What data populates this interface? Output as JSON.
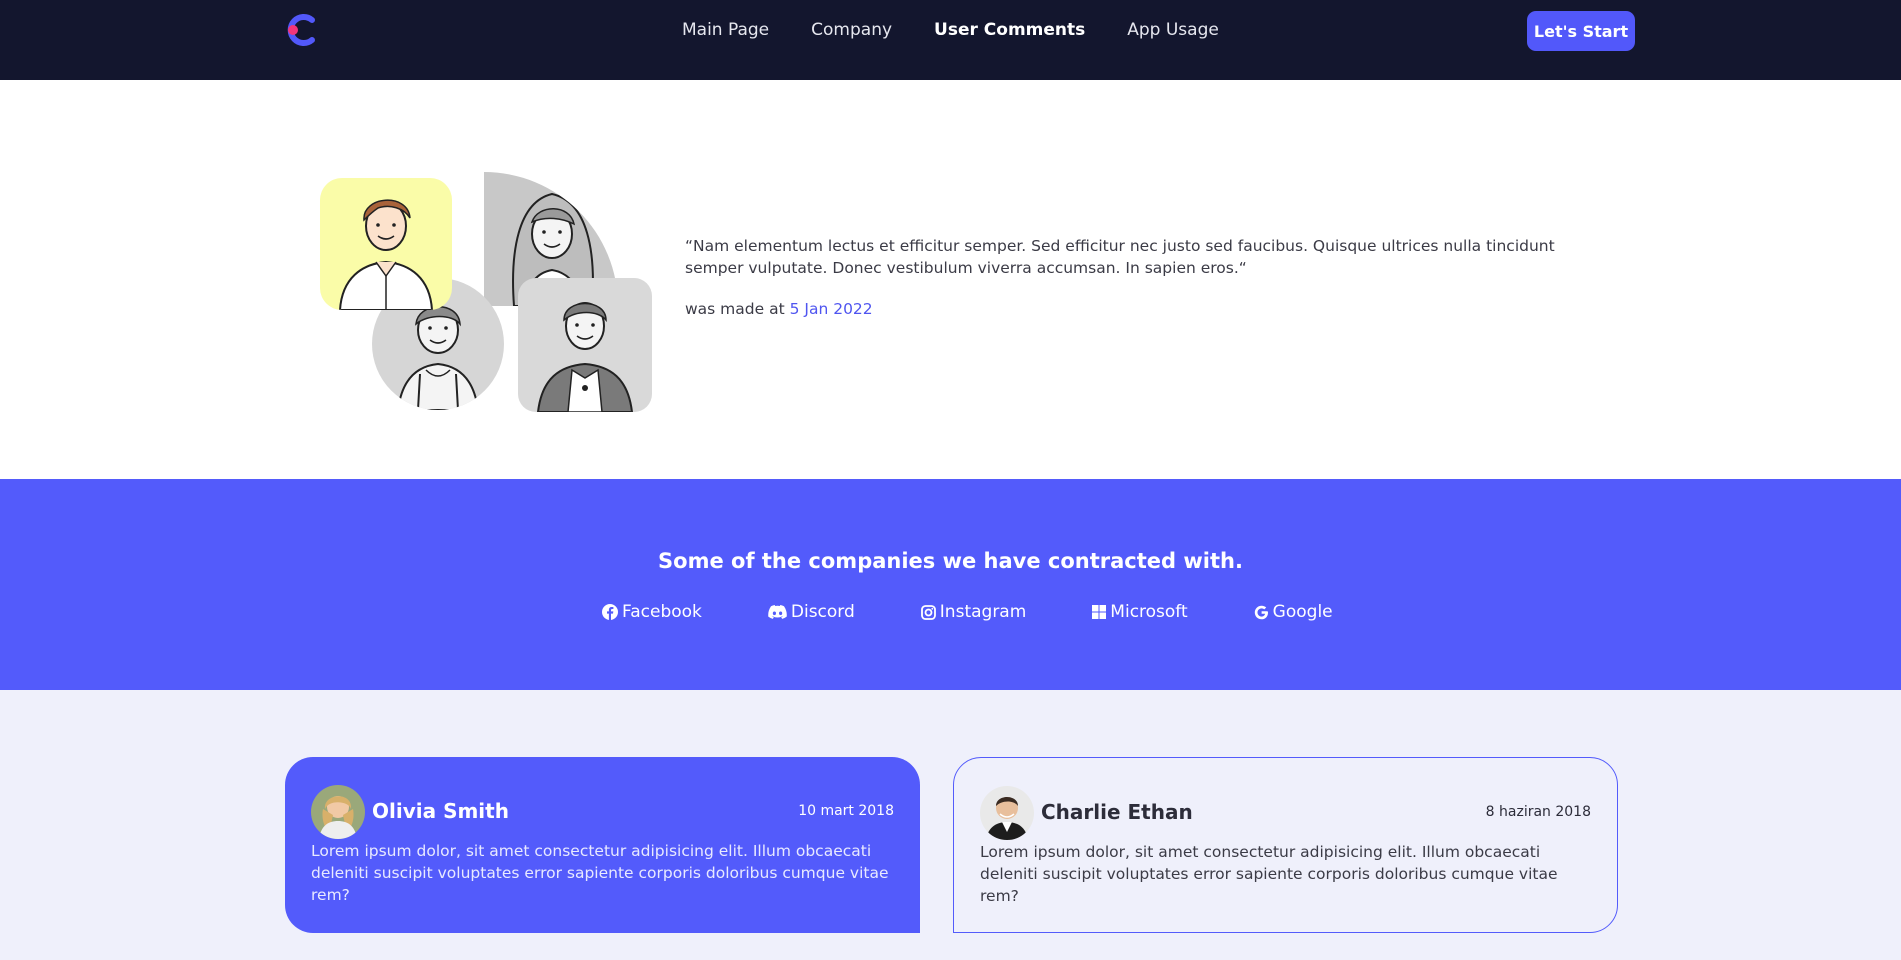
{
  "nav": {
    "logo_icon": "c-logo-icon",
    "links": [
      {
        "label": "Main Page"
      },
      {
        "label": "Company"
      },
      {
        "label": "User Comments",
        "active": true
      },
      {
        "label": "App Usage"
      }
    ],
    "cta_label": "Let's Start"
  },
  "testimonial": {
    "quote": "“Nam elementum lectus et efficitur semper. Sed efficitur nec justo sed faucibus. Quisque ultrices nulla tincidunt semper vulputate. Donec vestibulum viverra accumsan. In sapien eros.“",
    "made_prefix": "was made at",
    "date": "5 Jan 2022"
  },
  "companies": {
    "title": "Some of the companies we have contracted with.",
    "brands": [
      {
        "icon": "facebook-icon",
        "label": "Facebook"
      },
      {
        "icon": "discord-icon",
        "label": "Discord"
      },
      {
        "icon": "instagram-icon",
        "label": "Instagram"
      },
      {
        "icon": "microsoft-icon",
        "label": "Microsoft"
      },
      {
        "icon": "google-icon",
        "label": "Google"
      }
    ]
  },
  "reviews": [
    {
      "name": "Olivia Smith",
      "date": "10 mart 2018",
      "text": "Lorem ipsum dolor, sit amet consectetur adipisicing elit. Illum obcaecati deleniti suscipit voluptates error sapiente corporis doloribus cumque vitae rem?"
    },
    {
      "name": "Charlie Ethan",
      "date": "8 haziran 2018",
      "text": "Lorem ipsum dolor, sit amet consectetur adipisicing elit. Illum obcaecati deleniti suscipit voluptates error sapiente corporis doloribus cumque vitae rem?"
    }
  ],
  "colors": {
    "nav_bg": "#13162e",
    "accent": "#535bfb",
    "page_bg": "#eff0fb"
  }
}
